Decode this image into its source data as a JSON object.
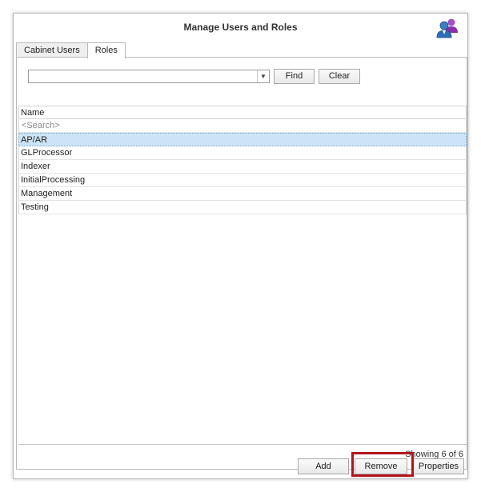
{
  "window": {
    "title": "Manage Users and Roles",
    "icon": "users-roles-icon"
  },
  "tabs": [
    {
      "label": "Cabinet Users",
      "active": false
    },
    {
      "label": "Roles",
      "active": true
    }
  ],
  "search_bar": {
    "combo_value": "",
    "find_label": "Find",
    "clear_label": "Clear"
  },
  "grid": {
    "column_header": "Name",
    "search_placeholder": "<Search>",
    "rows": [
      {
        "name": "AP/AR",
        "selected": true
      },
      {
        "name": "GLProcessor",
        "selected": false
      },
      {
        "name": "Indexer",
        "selected": false
      },
      {
        "name": "InitialProcessing",
        "selected": false
      },
      {
        "name": "Management",
        "selected": false
      },
      {
        "name": "Testing",
        "selected": false
      }
    ]
  },
  "status": {
    "showing": "Showing 6 of 6"
  },
  "actions": {
    "add_label": "Add",
    "remove_label": "Remove",
    "properties_label": "Properties"
  },
  "colors": {
    "selection": "#cce4f7",
    "highlight_border": "#b3141c"
  }
}
